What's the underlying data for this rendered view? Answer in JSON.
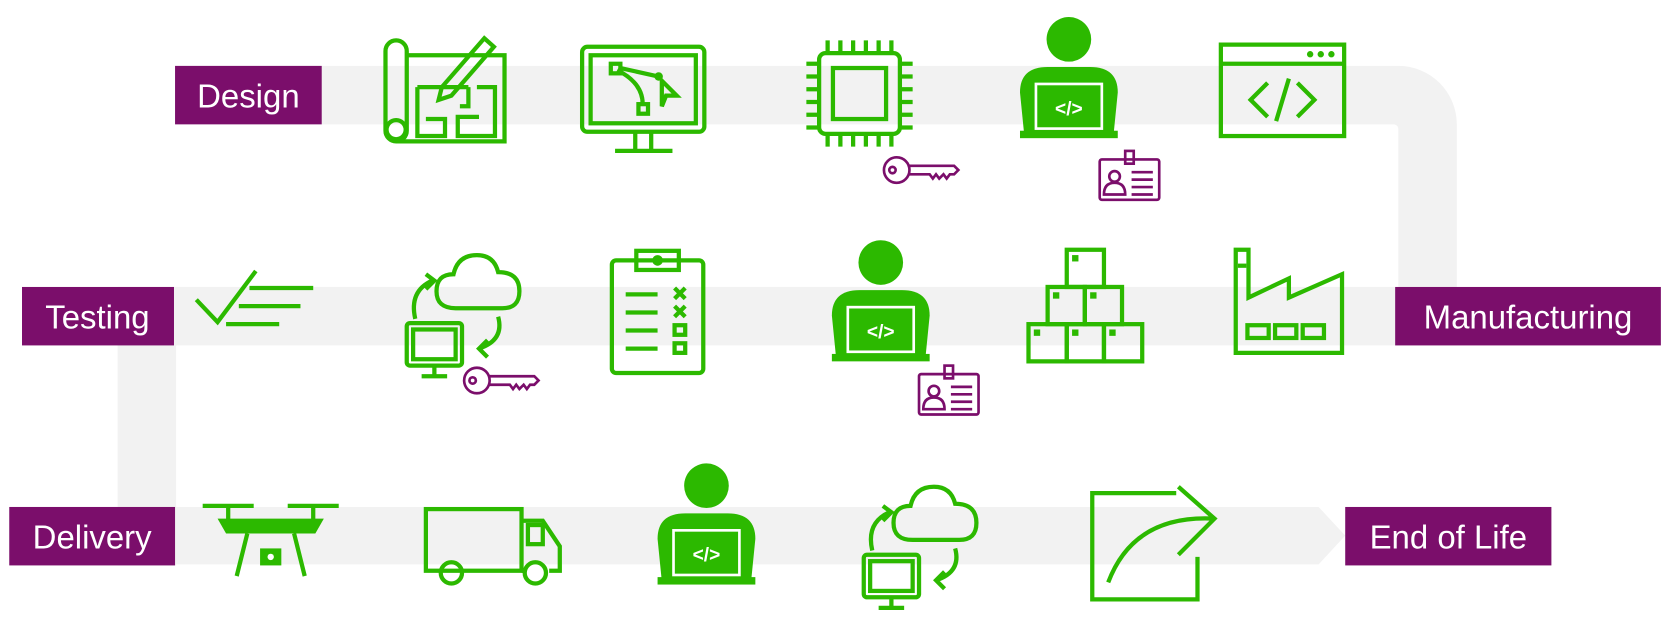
{
  "stages": {
    "design": "Design",
    "testing": "Testing",
    "manufacturing": "Manufacturing",
    "delivery": "Delivery",
    "end_of_life": "End of Life"
  },
  "code_glyph": "</>",
  "colors": {
    "icon_green": "#2cb900",
    "label_purple": "#7b0e6b",
    "path_gray": "#f2f2f2"
  },
  "icons": {
    "design_row": [
      "blueprint-icon",
      "monitor-bezier-icon",
      "chip-icon",
      "key-icon",
      "developer-icon",
      "id-badge-icon",
      "code-window-icon"
    ],
    "middle_row": [
      "checklist-icon",
      "cloud-sync-icon",
      "key-icon",
      "clipboard-icon",
      "developer-icon",
      "id-badge-icon",
      "boxes-icon",
      "factory-icon"
    ],
    "delivery_row": [
      "drone-icon",
      "truck-icon",
      "developer-icon",
      "cloud-sync-icon",
      "exit-arrow-icon"
    ]
  }
}
